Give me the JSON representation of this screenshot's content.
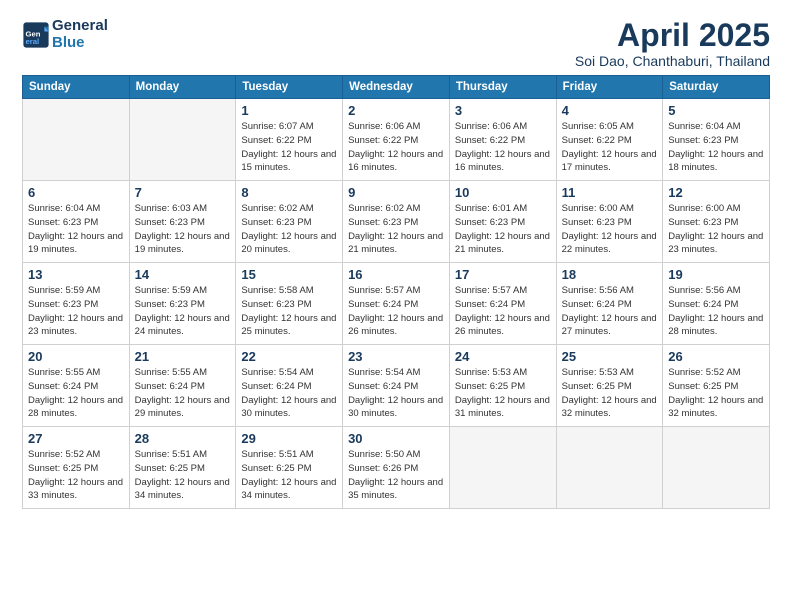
{
  "header": {
    "logo_line1": "General",
    "logo_line2": "Blue",
    "main_title": "April 2025",
    "sub_title": "Soi Dao, Chanthaburi, Thailand"
  },
  "weekdays": [
    "Sunday",
    "Monday",
    "Tuesday",
    "Wednesday",
    "Thursday",
    "Friday",
    "Saturday"
  ],
  "weeks": [
    [
      {
        "day": "",
        "empty": true
      },
      {
        "day": "",
        "empty": true
      },
      {
        "day": "1",
        "sunrise": "Sunrise: 6:07 AM",
        "sunset": "Sunset: 6:22 PM",
        "daylight": "Daylight: 12 hours and 15 minutes."
      },
      {
        "day": "2",
        "sunrise": "Sunrise: 6:06 AM",
        "sunset": "Sunset: 6:22 PM",
        "daylight": "Daylight: 12 hours and 16 minutes."
      },
      {
        "day": "3",
        "sunrise": "Sunrise: 6:06 AM",
        "sunset": "Sunset: 6:22 PM",
        "daylight": "Daylight: 12 hours and 16 minutes."
      },
      {
        "day": "4",
        "sunrise": "Sunrise: 6:05 AM",
        "sunset": "Sunset: 6:22 PM",
        "daylight": "Daylight: 12 hours and 17 minutes."
      },
      {
        "day": "5",
        "sunrise": "Sunrise: 6:04 AM",
        "sunset": "Sunset: 6:23 PM",
        "daylight": "Daylight: 12 hours and 18 minutes."
      }
    ],
    [
      {
        "day": "6",
        "sunrise": "Sunrise: 6:04 AM",
        "sunset": "Sunset: 6:23 PM",
        "daylight": "Daylight: 12 hours and 19 minutes."
      },
      {
        "day": "7",
        "sunrise": "Sunrise: 6:03 AM",
        "sunset": "Sunset: 6:23 PM",
        "daylight": "Daylight: 12 hours and 19 minutes."
      },
      {
        "day": "8",
        "sunrise": "Sunrise: 6:02 AM",
        "sunset": "Sunset: 6:23 PM",
        "daylight": "Daylight: 12 hours and 20 minutes."
      },
      {
        "day": "9",
        "sunrise": "Sunrise: 6:02 AM",
        "sunset": "Sunset: 6:23 PM",
        "daylight": "Daylight: 12 hours and 21 minutes."
      },
      {
        "day": "10",
        "sunrise": "Sunrise: 6:01 AM",
        "sunset": "Sunset: 6:23 PM",
        "daylight": "Daylight: 12 hours and 21 minutes."
      },
      {
        "day": "11",
        "sunrise": "Sunrise: 6:00 AM",
        "sunset": "Sunset: 6:23 PM",
        "daylight": "Daylight: 12 hours and 22 minutes."
      },
      {
        "day": "12",
        "sunrise": "Sunrise: 6:00 AM",
        "sunset": "Sunset: 6:23 PM",
        "daylight": "Daylight: 12 hours and 23 minutes."
      }
    ],
    [
      {
        "day": "13",
        "sunrise": "Sunrise: 5:59 AM",
        "sunset": "Sunset: 6:23 PM",
        "daylight": "Daylight: 12 hours and 23 minutes."
      },
      {
        "day": "14",
        "sunrise": "Sunrise: 5:59 AM",
        "sunset": "Sunset: 6:23 PM",
        "daylight": "Daylight: 12 hours and 24 minutes."
      },
      {
        "day": "15",
        "sunrise": "Sunrise: 5:58 AM",
        "sunset": "Sunset: 6:23 PM",
        "daylight": "Daylight: 12 hours and 25 minutes."
      },
      {
        "day": "16",
        "sunrise": "Sunrise: 5:57 AM",
        "sunset": "Sunset: 6:24 PM",
        "daylight": "Daylight: 12 hours and 26 minutes."
      },
      {
        "day": "17",
        "sunrise": "Sunrise: 5:57 AM",
        "sunset": "Sunset: 6:24 PM",
        "daylight": "Daylight: 12 hours and 26 minutes."
      },
      {
        "day": "18",
        "sunrise": "Sunrise: 5:56 AM",
        "sunset": "Sunset: 6:24 PM",
        "daylight": "Daylight: 12 hours and 27 minutes."
      },
      {
        "day": "19",
        "sunrise": "Sunrise: 5:56 AM",
        "sunset": "Sunset: 6:24 PM",
        "daylight": "Daylight: 12 hours and 28 minutes."
      }
    ],
    [
      {
        "day": "20",
        "sunrise": "Sunrise: 5:55 AM",
        "sunset": "Sunset: 6:24 PM",
        "daylight": "Daylight: 12 hours and 28 minutes."
      },
      {
        "day": "21",
        "sunrise": "Sunrise: 5:55 AM",
        "sunset": "Sunset: 6:24 PM",
        "daylight": "Daylight: 12 hours and 29 minutes."
      },
      {
        "day": "22",
        "sunrise": "Sunrise: 5:54 AM",
        "sunset": "Sunset: 6:24 PM",
        "daylight": "Daylight: 12 hours and 30 minutes."
      },
      {
        "day": "23",
        "sunrise": "Sunrise: 5:54 AM",
        "sunset": "Sunset: 6:24 PM",
        "daylight": "Daylight: 12 hours and 30 minutes."
      },
      {
        "day": "24",
        "sunrise": "Sunrise: 5:53 AM",
        "sunset": "Sunset: 6:25 PM",
        "daylight": "Daylight: 12 hours and 31 minutes."
      },
      {
        "day": "25",
        "sunrise": "Sunrise: 5:53 AM",
        "sunset": "Sunset: 6:25 PM",
        "daylight": "Daylight: 12 hours and 32 minutes."
      },
      {
        "day": "26",
        "sunrise": "Sunrise: 5:52 AM",
        "sunset": "Sunset: 6:25 PM",
        "daylight": "Daylight: 12 hours and 32 minutes."
      }
    ],
    [
      {
        "day": "27",
        "sunrise": "Sunrise: 5:52 AM",
        "sunset": "Sunset: 6:25 PM",
        "daylight": "Daylight: 12 hours and 33 minutes."
      },
      {
        "day": "28",
        "sunrise": "Sunrise: 5:51 AM",
        "sunset": "Sunset: 6:25 PM",
        "daylight": "Daylight: 12 hours and 34 minutes."
      },
      {
        "day": "29",
        "sunrise": "Sunrise: 5:51 AM",
        "sunset": "Sunset: 6:25 PM",
        "daylight": "Daylight: 12 hours and 34 minutes."
      },
      {
        "day": "30",
        "sunrise": "Sunrise: 5:50 AM",
        "sunset": "Sunset: 6:26 PM",
        "daylight": "Daylight: 12 hours and 35 minutes."
      },
      {
        "day": "",
        "empty": true
      },
      {
        "day": "",
        "empty": true
      },
      {
        "day": "",
        "empty": true
      }
    ]
  ]
}
